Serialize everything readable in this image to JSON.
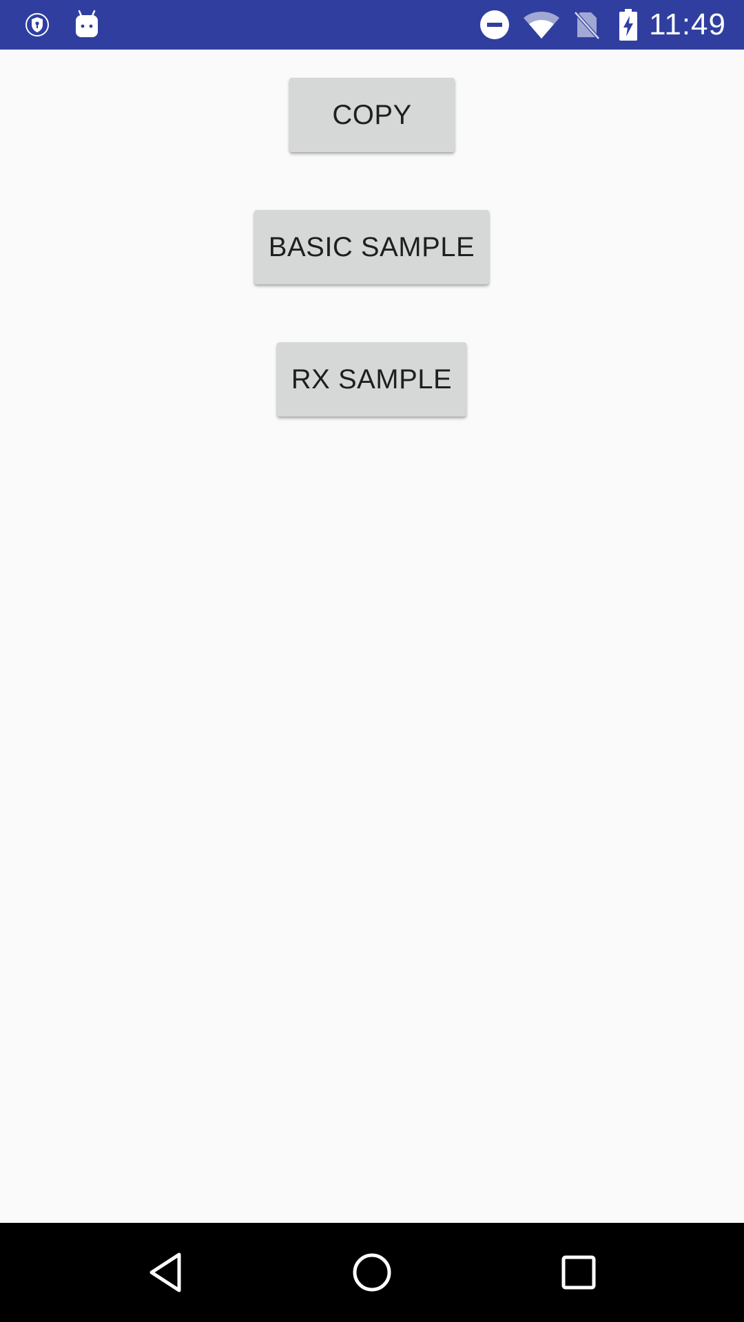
{
  "status_bar": {
    "time": "11:49",
    "background_color": "#303f9f",
    "icons": [
      "vpn-shield-icon",
      "android-robot-icon",
      "do-not-disturb-icon",
      "wifi-icon",
      "no-sim-icon",
      "battery-charging-icon"
    ]
  },
  "buttons": {
    "copy_label": "COPY",
    "basic_sample_label": "BASIC SAMPLE",
    "rx_sample_label": "RX SAMPLE",
    "background_color": "#d6d7d7"
  },
  "nav_bar": {
    "icons": [
      "back-icon",
      "home-icon",
      "recents-icon"
    ]
  }
}
